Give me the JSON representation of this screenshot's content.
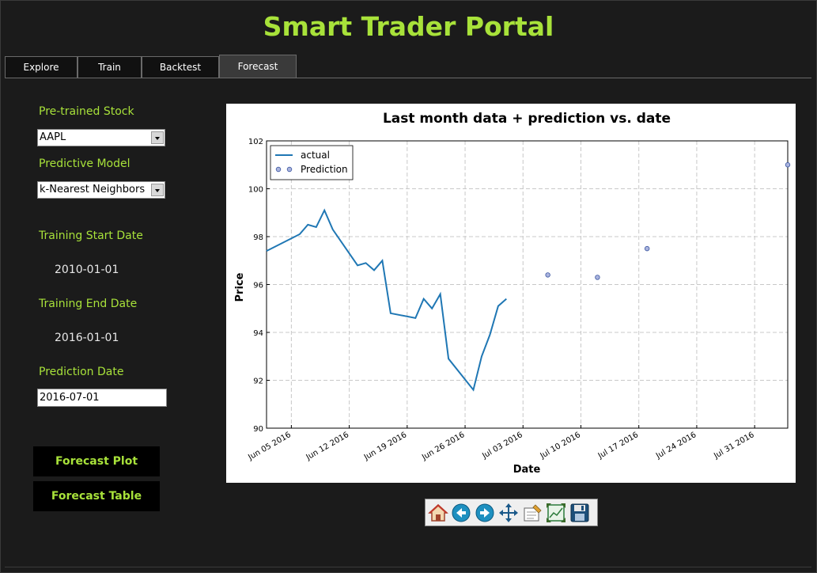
{
  "app": {
    "title": "Smart Trader Portal"
  },
  "tabs": [
    {
      "label": "Explore",
      "active": false
    },
    {
      "label": "Train",
      "active": false
    },
    {
      "label": "Backtest",
      "active": false
    },
    {
      "label": "Forecast",
      "active": true
    }
  ],
  "form": {
    "stock_label": "Pre-trained Stock",
    "stock_value": "AAPL",
    "model_label": "Predictive Model",
    "model_value": "k-Nearest Neighbors",
    "train_start_label": "Training Start Date",
    "train_start_value": "2010-01-01",
    "train_end_label": "Training End Date",
    "train_end_value": "2016-01-01",
    "pred_date_label": "Prediction Date",
    "pred_date_value": "2016-07-01"
  },
  "buttons": {
    "plot": "Forecast Plot",
    "table": "Forecast Table"
  },
  "colors": {
    "accent": "#a8e23a",
    "line": "#1f77b4",
    "background": "#1b1b1b"
  },
  "toolbar": {
    "icons": [
      "home-icon",
      "back-icon",
      "forward-icon",
      "pan-icon",
      "configure-subplots-icon",
      "zoom-icon",
      "save-icon"
    ]
  },
  "chart_data": {
    "type": "line",
    "title": "Last month data + prediction vs. date",
    "xlabel": "Date",
    "ylabel": "Price",
    "ylim": [
      90,
      102
    ],
    "xlim": [
      "2016-06-02",
      "2016-08-04"
    ],
    "grid": true,
    "legend_position": "top-left",
    "y_ticks": [
      "90",
      "92",
      "94",
      "96",
      "98",
      "100",
      "102"
    ],
    "x_ticks": [
      "Jun 05 2016",
      "Jun 12 2016",
      "Jun 19 2016",
      "Jun 26 2016",
      "Jul 03 2016",
      "Jul 10 2016",
      "Jul 17 2016",
      "Jul 24 2016",
      "Jul 31 2016"
    ],
    "series": [
      {
        "name": "actual",
        "style": "line",
        "points": [
          [
            "2016-06-02",
            97.4
          ],
          [
            "2016-06-06",
            98.1
          ],
          [
            "2016-06-07",
            98.5
          ],
          [
            "2016-06-08",
            98.4
          ],
          [
            "2016-06-09",
            99.1
          ],
          [
            "2016-06-10",
            98.3
          ],
          [
            "2016-06-13",
            96.8
          ],
          [
            "2016-06-14",
            96.9
          ],
          [
            "2016-06-15",
            96.6
          ],
          [
            "2016-06-16",
            97.0
          ],
          [
            "2016-06-17",
            94.8
          ],
          [
            "2016-06-20",
            94.6
          ],
          [
            "2016-06-21",
            95.4
          ],
          [
            "2016-06-22",
            95.0
          ],
          [
            "2016-06-23",
            95.6
          ],
          [
            "2016-06-24",
            92.9
          ],
          [
            "2016-06-27",
            91.6
          ],
          [
            "2016-06-28",
            93.0
          ],
          [
            "2016-06-29",
            93.9
          ],
          [
            "2016-06-30",
            95.1
          ],
          [
            "2016-07-01",
            95.4
          ]
        ]
      },
      {
        "name": "Prediction",
        "style": "scatter",
        "points": [
          [
            "2016-07-06",
            96.4
          ],
          [
            "2016-07-12",
            96.3
          ],
          [
            "2016-07-18",
            97.5
          ],
          [
            "2016-08-04",
            101.0
          ]
        ]
      }
    ]
  }
}
